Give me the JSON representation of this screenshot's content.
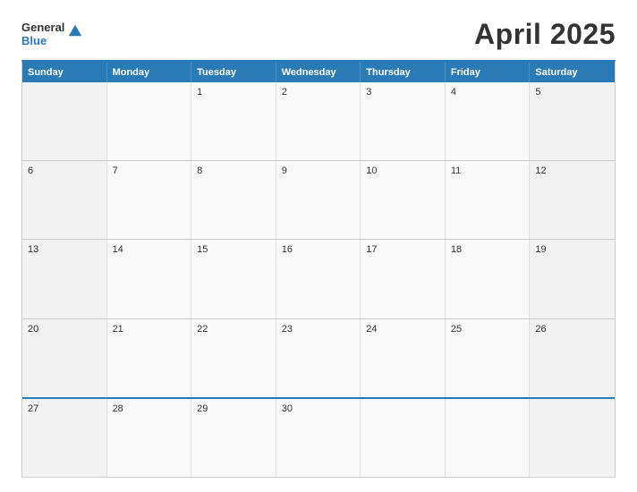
{
  "header": {
    "logo": {
      "general": "General",
      "triangle_icon": "▶",
      "blue": "Blue"
    },
    "title": "April 2025"
  },
  "calendar": {
    "day_headers": [
      "Sunday",
      "Monday",
      "Tuesday",
      "Wednesday",
      "Thursday",
      "Friday",
      "Saturday"
    ],
    "weeks": [
      [
        "",
        "",
        "1",
        "2",
        "3",
        "4",
        "5"
      ],
      [
        "6",
        "7",
        "8",
        "9",
        "10",
        "11",
        "12"
      ],
      [
        "13",
        "14",
        "15",
        "16",
        "17",
        "18",
        "19"
      ],
      [
        "20",
        "21",
        "22",
        "23",
        "24",
        "25",
        "26"
      ],
      [
        "27",
        "28",
        "29",
        "30",
        "",
        "",
        ""
      ]
    ]
  }
}
